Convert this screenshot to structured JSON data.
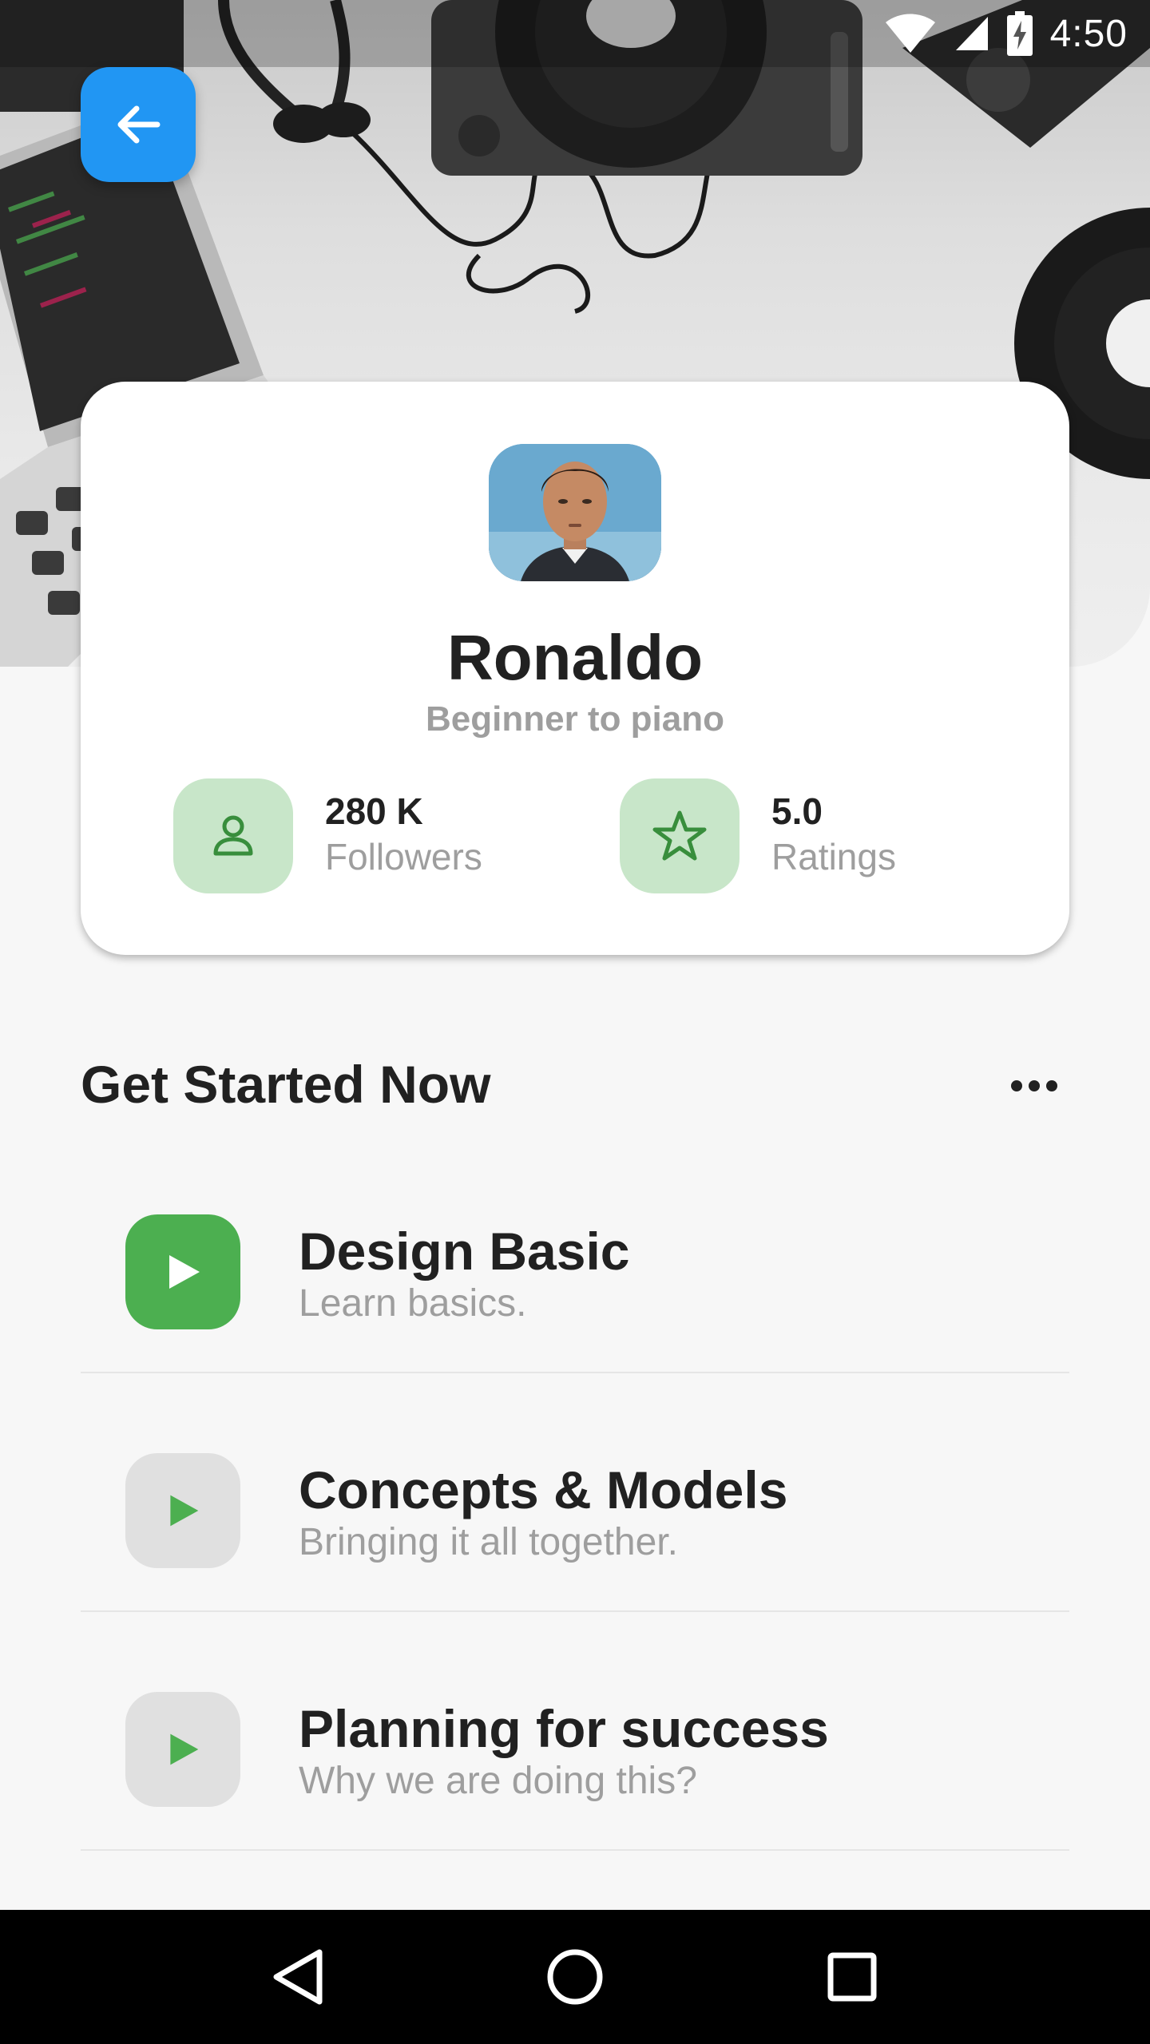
{
  "status_bar": {
    "time": "4:50"
  },
  "profile": {
    "name": "Ronaldo",
    "subtitle": "Beginner to piano",
    "stats": [
      {
        "value": "280 K",
        "label": "Followers",
        "icon": "person-icon"
      },
      {
        "value": "5.0",
        "label": "Ratings",
        "icon": "star-icon"
      }
    ]
  },
  "section": {
    "title": "Get Started Now",
    "more_icon": "more-horizontal-icon"
  },
  "lessons": [
    {
      "title": "Design Basic",
      "subtitle": "Learn basics.",
      "active": true
    },
    {
      "title": "Concepts & Models",
      "subtitle": "Bringing it all together.",
      "active": false
    },
    {
      "title": "Planning for success",
      "subtitle": "Why we are doing this?",
      "active": false
    }
  ],
  "colors": {
    "accent_blue": "#2196f3",
    "accent_green": "#4caf50",
    "green_light": "#c8e6c9",
    "play_inactive": "#e0e0e0"
  }
}
